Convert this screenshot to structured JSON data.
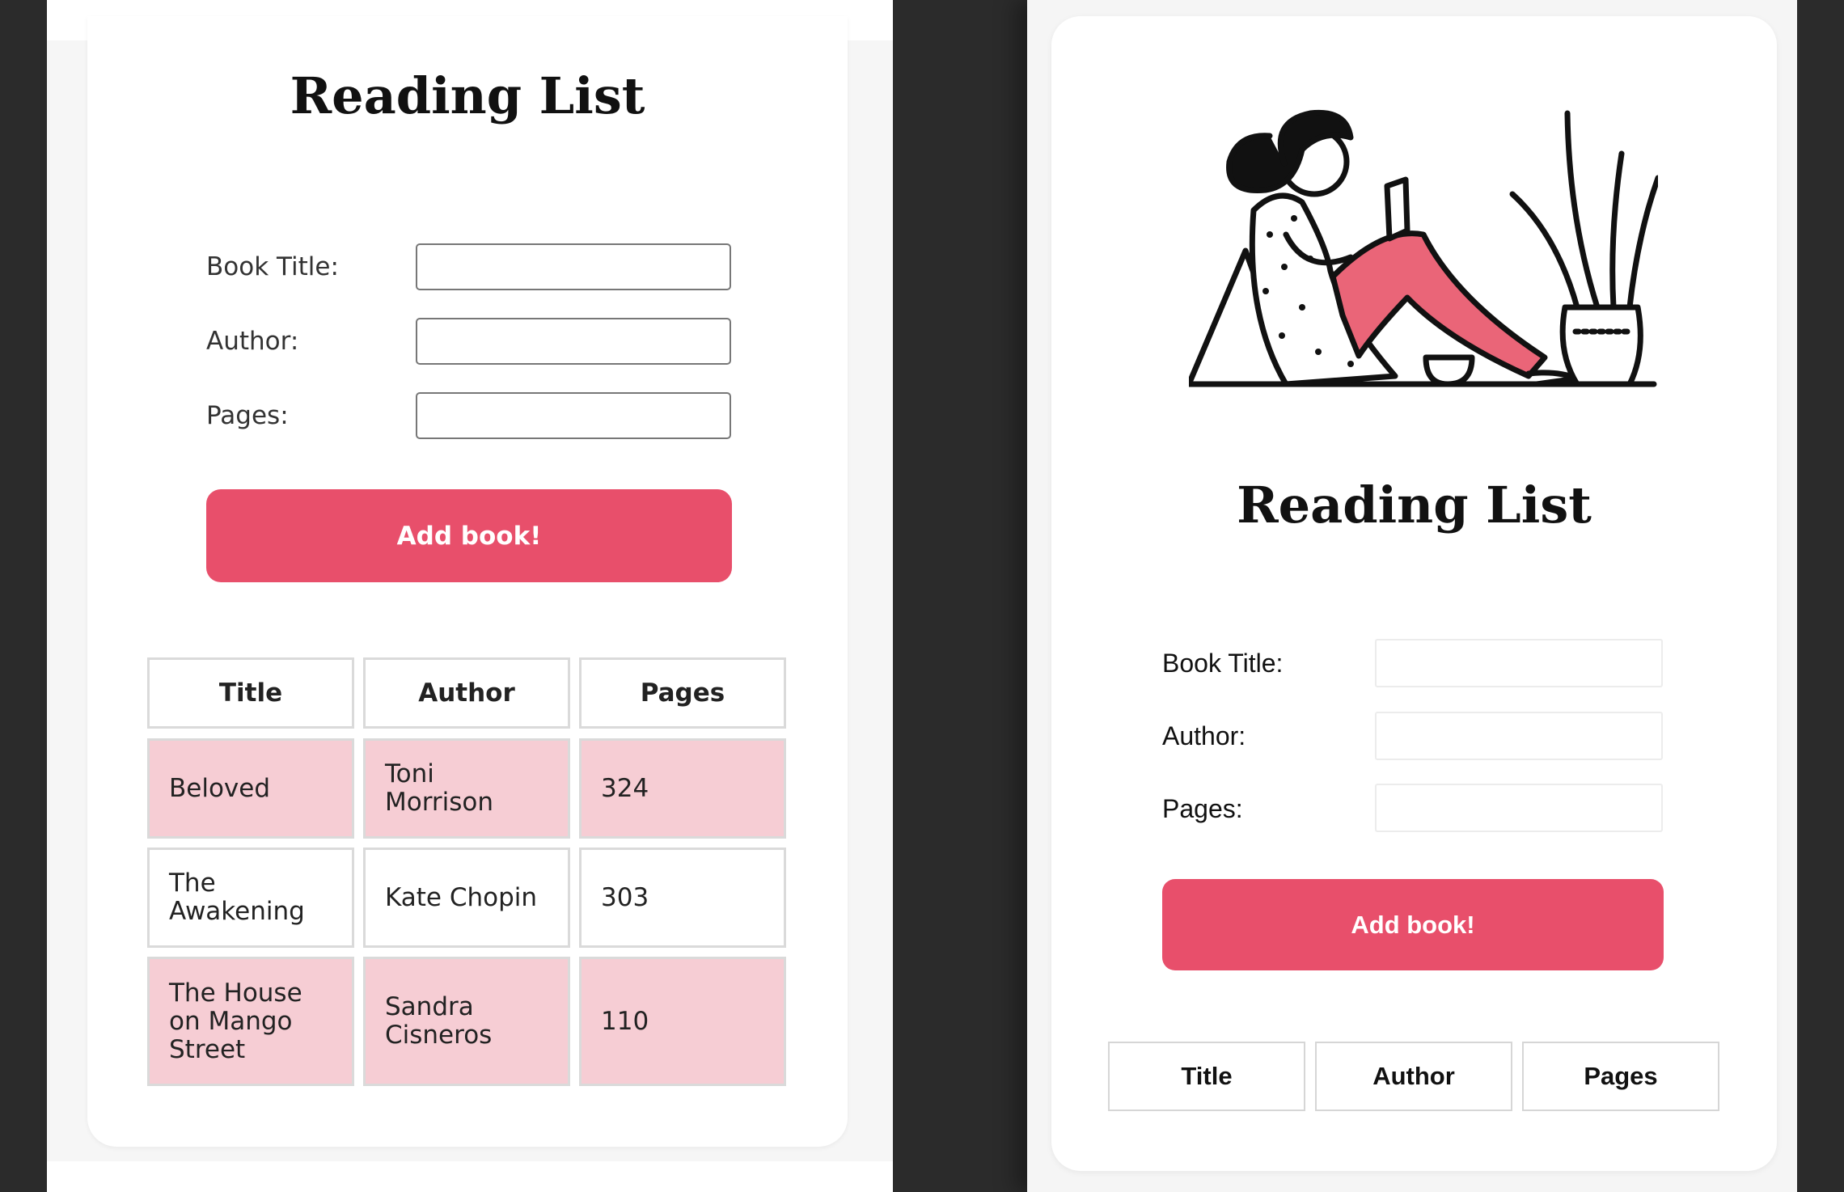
{
  "left": {
    "title": "Reading List",
    "form": {
      "title_label": "Book Title:",
      "author_label": "Author:",
      "pages_label": "Pages:",
      "title_value": "",
      "author_value": "",
      "pages_value": "",
      "add_button": "Add book!"
    },
    "table": {
      "headers": [
        "Title",
        "Author",
        "Pages"
      ],
      "rows": [
        {
          "title": "Beloved",
          "author": "Toni Morrison",
          "pages": "324"
        },
        {
          "title": "The Awakening",
          "author": "Kate Chopin",
          "pages": "303"
        },
        {
          "title": "The House on Mango Street",
          "author": "Sandra Cisneros",
          "pages": "110"
        }
      ]
    }
  },
  "right": {
    "illustration": "woman-reading-illustration",
    "title": "Reading List",
    "form": {
      "title_label": "Book Title:",
      "author_label": "Author:",
      "pages_label": "Pages:",
      "title_value": "",
      "author_value": "",
      "pages_value": "",
      "add_button": "Add book!"
    },
    "table": {
      "headers": [
        "Title",
        "Author",
        "Pages"
      ]
    }
  },
  "colors": {
    "accent": "#e84f6b",
    "row_highlight": "#f6cdd4",
    "background_dark": "#2b2b2b"
  }
}
